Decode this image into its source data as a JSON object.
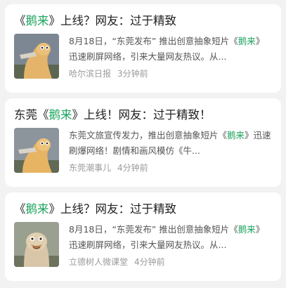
{
  "feed": {
    "cards": [
      {
        "title_prefix": "《",
        "title_highlight": "鹅来",
        "title_suffix": "》上线？网友：过于精致",
        "summary_before": "8月18日，“东莞发布” 推出创意抽象短片《",
        "summary_highlight": "鹅来",
        "summary_after": "》迅速刷屏网络，引来大量网友热议。从...",
        "source": "哈尔滨日报",
        "time": "3分钟前",
        "thumb_icon": "goose-thumbnail"
      },
      {
        "title_prefix": "东莞《",
        "title_highlight": "鹅来",
        "title_suffix": "》上线！网友：过于精致！",
        "summary_before": "东莞文旅宣传发力，推出创意抽象短片《",
        "summary_highlight": "鹅来",
        "summary_after": "》迅速刷爆网络！剧情和画风模仿《牛...",
        "source": "东莞潮事儿",
        "time": "4分钟前",
        "thumb_icon": "goose-thumbnail"
      },
      {
        "title_prefix": "《",
        "title_highlight": "鹅来",
        "title_suffix": "》上线？网友：过于精致",
        "summary_before": "8月18日，“东莞发布” 推出创意抽象短片《",
        "summary_highlight": "鹅来",
        "summary_after": "》迅速刷屏网络，引来大量网友热议。从...",
        "source": "立德树人微课堂",
        "time": "4分钟前",
        "thumb_icon": "goose-face-thumbnail"
      }
    ]
  },
  "colors": {
    "highlight": "#1aa35c",
    "title": "#222222",
    "summary": "#555555",
    "meta": "#9a9a9a",
    "background": "#f2f2f2"
  }
}
